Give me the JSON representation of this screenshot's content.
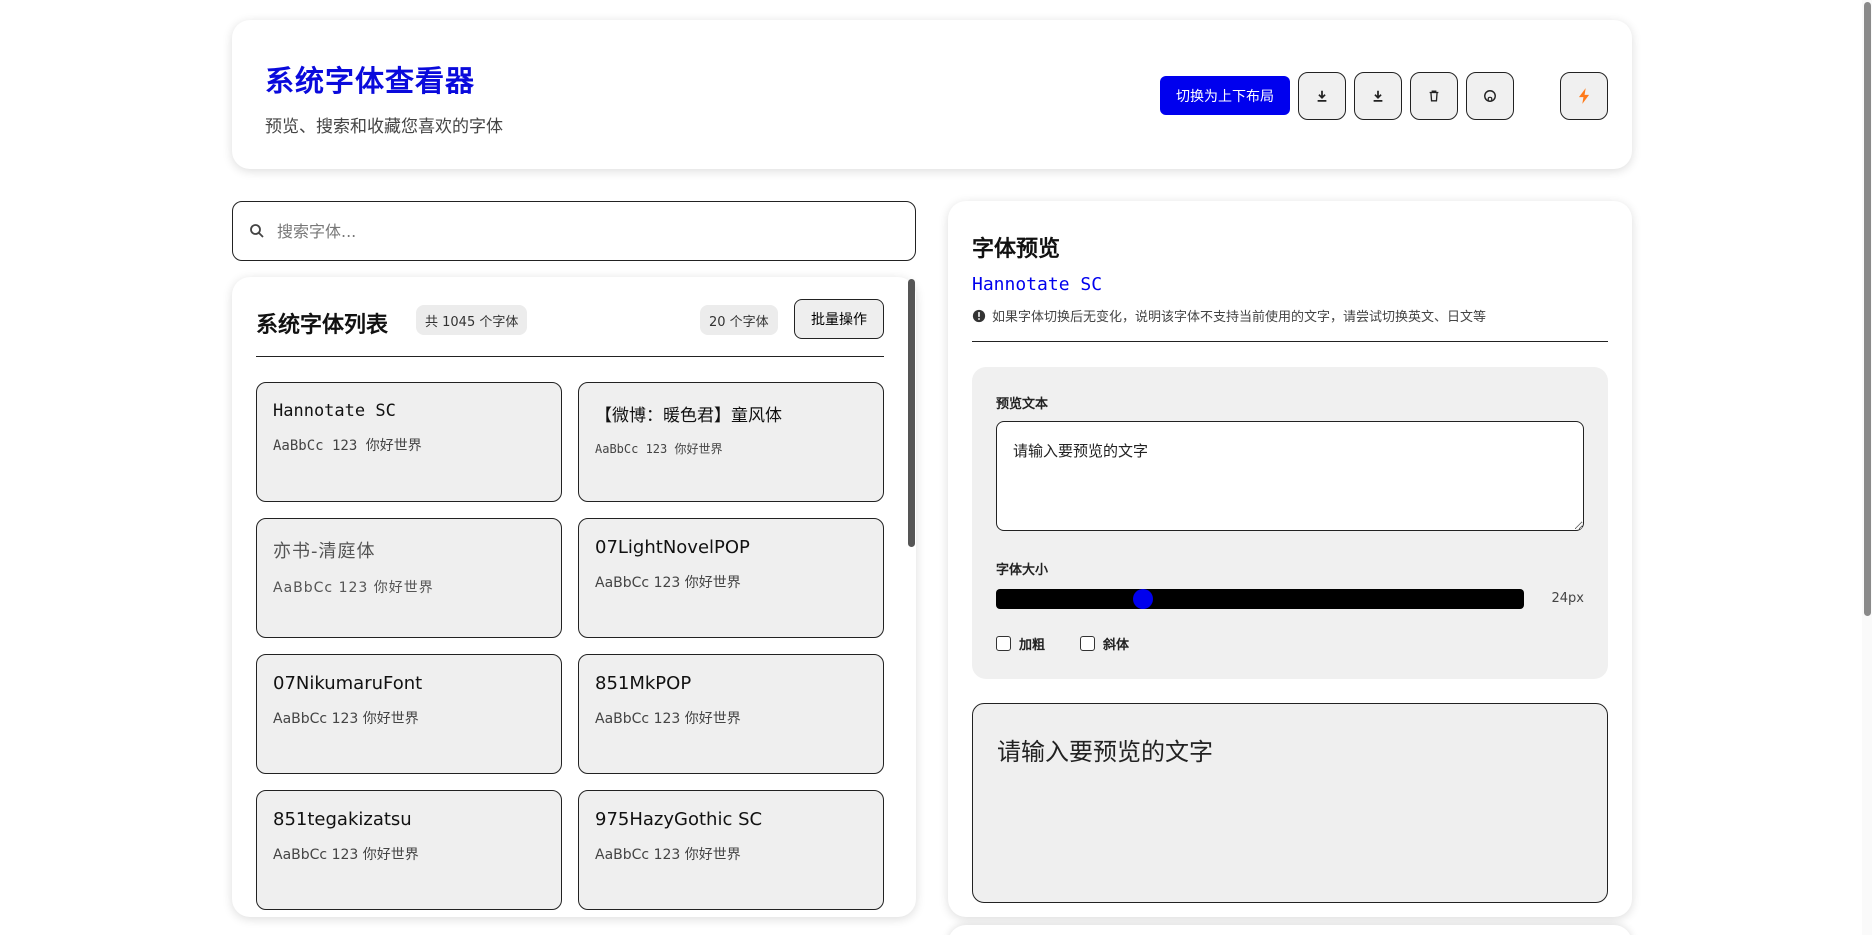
{
  "header": {
    "title": "系统字体查看器",
    "subtitle": "预览、搜索和收藏您喜欢的字体",
    "layout_toggle_label": "切换为上下布局",
    "icon_buttons": [
      "download-icon",
      "download-icon",
      "trash-icon",
      "github-icon"
    ],
    "quick_button_icon": "lightning-icon",
    "accent_color": "#0000ee",
    "lightning_color": "#ff7a1a"
  },
  "search": {
    "placeholder": "搜索字体..."
  },
  "font_list": {
    "title": "系统字体列表",
    "total_badge": "共 1045 个字体",
    "count_badge": "20 个字体",
    "batch_label": "批量操作",
    "items": [
      {
        "name": "Hannotate SC",
        "sample": "AaBbCc 123 你好世界"
      },
      {
        "name": "【微博：暖色君】童风体",
        "sample": "AaBbCc 123 你好世界"
      },
      {
        "name": "亦书-清庭体",
        "sample": "AaBbCc 123 你好世界"
      },
      {
        "name": "07LightNovelPOP",
        "sample": "AaBbCc 123 你好世界"
      },
      {
        "name": "07NikumaruFont",
        "sample": "AaBbCc 123 你好世界"
      },
      {
        "name": "851MkPOP",
        "sample": "AaBbCc 123 你好世界"
      },
      {
        "name": "851tegakizatsu",
        "sample": "AaBbCc 123 你好世界"
      },
      {
        "name": "975HazyGothic SC",
        "sample": "AaBbCc 123 你好世界"
      }
    ]
  },
  "preview": {
    "title": "字体预览",
    "current_font": "Hannotate SC",
    "notice": "如果字体切换后无变化，说明该字体不支持当前使用的文字，请尝试切换英文、日文等",
    "text_label": "预览文本",
    "text_value": "请输入要预览的文字",
    "size_label": "字体大小",
    "size_value": "24px",
    "size_fraction": 0.27,
    "bold_label": "加粗",
    "italic_label": "斜体",
    "bold_checked": false,
    "italic_checked": false,
    "output_text": "请输入要预览的文字"
  }
}
